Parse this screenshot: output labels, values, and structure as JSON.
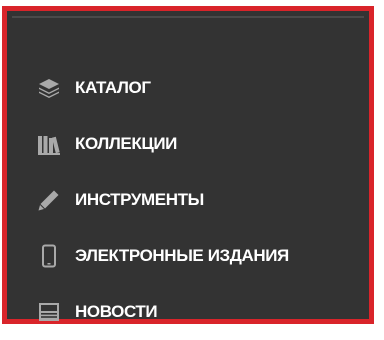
{
  "menu": {
    "items": [
      {
        "label": "КАТАЛОГ",
        "icon": "layers-icon"
      },
      {
        "label": "КОЛЛЕКЦИИ",
        "icon": "books-icon"
      },
      {
        "label": "ИНСТРУМЕНТЫ",
        "icon": "pencil-icon"
      },
      {
        "label": "ЭЛЕКТРОННЫЕ ИЗДАНИЯ",
        "icon": "smartphone-icon"
      },
      {
        "label": "НОВОСТИ",
        "icon": "newspaper-icon"
      }
    ]
  },
  "colors": {
    "frame_border": "#d9242a",
    "menu_background": "#333333",
    "icon": "#a9a9a9",
    "text": "#ffffff"
  }
}
